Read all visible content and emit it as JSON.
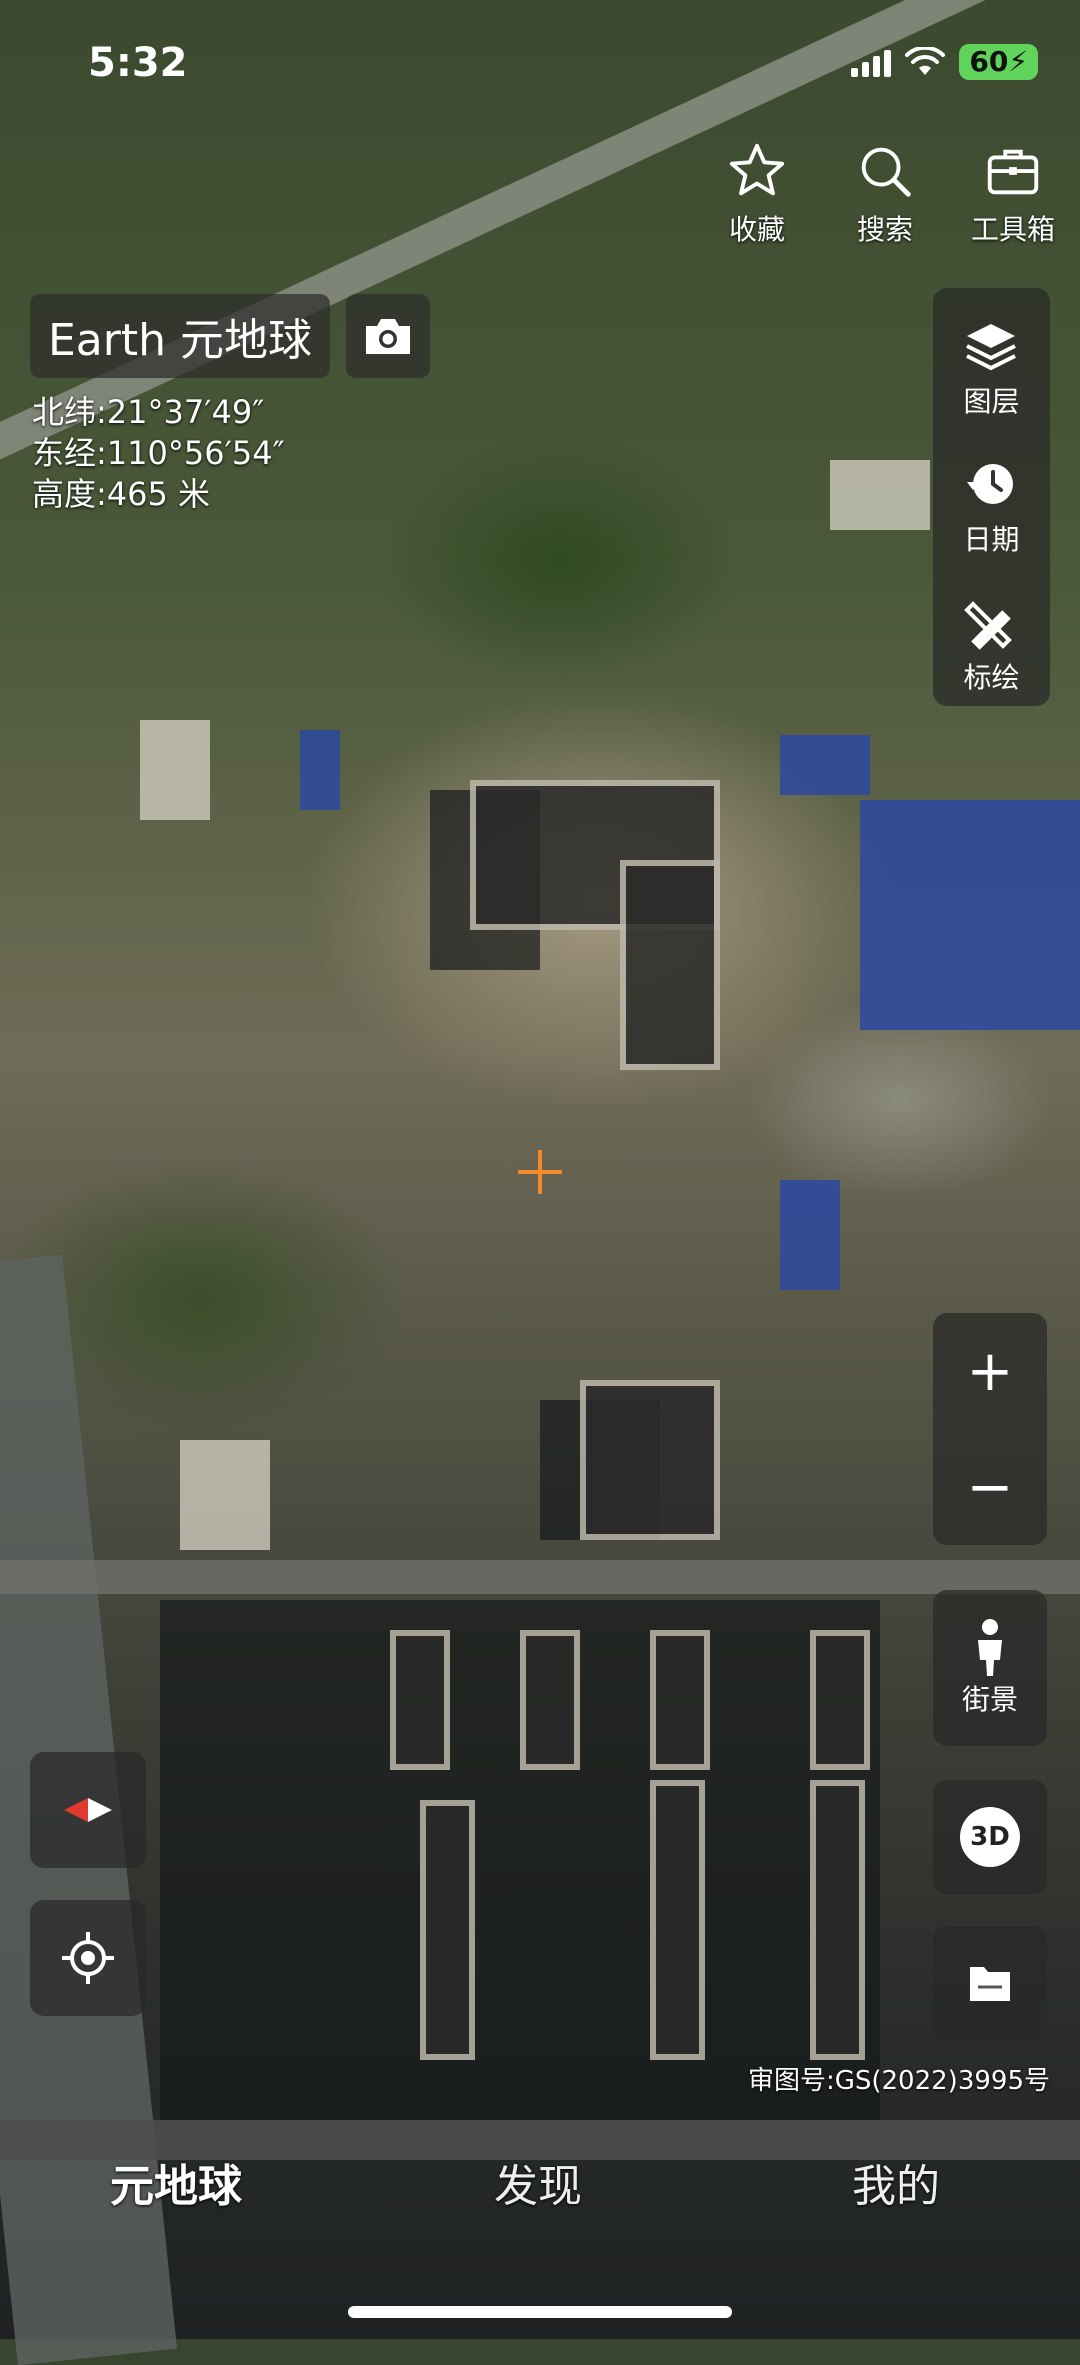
{
  "status": {
    "time": "5:32",
    "battery": "60"
  },
  "top_actions": [
    {
      "label": "收藏",
      "icon": "star-icon"
    },
    {
      "label": "搜索",
      "icon": "search-icon"
    },
    {
      "label": "工具箱",
      "icon": "toolbox-icon"
    }
  ],
  "title": "Earth 元地球",
  "coordinates": {
    "lat": "北纬:21°37′49″",
    "lng": "东经:110°56′54″",
    "alt": "高度:465 米"
  },
  "tools": [
    {
      "label": "图层",
      "icon": "layers-icon"
    },
    {
      "label": "日期",
      "icon": "clock-icon"
    },
    {
      "label": "标绘",
      "icon": "ruler-pencil-icon"
    }
  ],
  "zoom": {
    "in": "+",
    "out": "−"
  },
  "street_view": "街景",
  "threed": "3D",
  "approval_number": "审图号:GS(2022)3995号",
  "nav": [
    {
      "label": "元地球",
      "active": true
    },
    {
      "label": "发现",
      "active": false
    },
    {
      "label": "我的",
      "active": false
    }
  ]
}
